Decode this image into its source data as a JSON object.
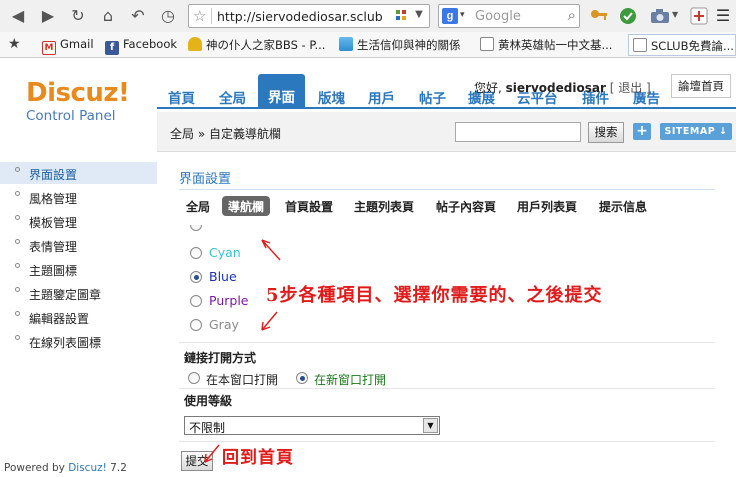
{
  "browser": {
    "url": "http://siervodediosar.sclub",
    "search_placeholder": "Google",
    "search_engine_letter": "g",
    "bookmarks": [
      {
        "label": "Gmail",
        "icon": "gmail-icon",
        "color": "#d93025"
      },
      {
        "label": "Facebook",
        "icon": "facebook-icon",
        "color": "#3b5998"
      },
      {
        "label": "神の仆人之家BBS - P...",
        "icon": "trophy-icon",
        "color": "#e4b21b"
      },
      {
        "label": "生活信仰與神的關係",
        "icon": "photo-icon",
        "color": "#2f8fd0"
      },
      {
        "label": "黄林英雄帖一中文基...",
        "icon": "page-icon",
        "color": "#ffffff"
      },
      {
        "label": "SCLUB免費論...",
        "icon": "page-icon",
        "color": "#ffffff"
      }
    ]
  },
  "logo": {
    "title": "Discuz!",
    "subtitle": "Control Panel"
  },
  "nav": {
    "items": [
      "首頁",
      "全局",
      "界面",
      "版塊",
      "用戶",
      "帖子",
      "擴展",
      "云平台",
      "插件",
      "廣告"
    ],
    "active_index": 2
  },
  "user": {
    "greeting": "您好,",
    "name": "siervodediosar",
    "logout": "[ 退出 ]",
    "home_button": "論壇首頁"
  },
  "breadcrumb": {
    "home": "全局",
    "sep": "»",
    "current": "自定義導航欄"
  },
  "quick_search": {
    "button": "搜索",
    "plus": "+",
    "sitemap": "SITEMAP ↓"
  },
  "sidebar": {
    "items": [
      "界面設置",
      "風格管理",
      "模板管理",
      "表情管理",
      "主題圖標",
      "主題鑒定圖章",
      "編輯器設置",
      "在線列表圖標"
    ],
    "active_index": 0,
    "powered_prefix": "Powered by",
    "powered_brand": "Discuz!",
    "powered_version": "7.2"
  },
  "main": {
    "title": "界面設置",
    "tabs": [
      "全局",
      "導航欄",
      "首頁設置",
      "主題列表頁",
      "帖子內容頁",
      "用戶列表頁",
      "提示信息"
    ],
    "active_tab_index": 1,
    "color_options": [
      {
        "label": "Cyan",
        "color": "#36c2d6",
        "selected": false
      },
      {
        "label": "Blue",
        "color": "#1c2fb7",
        "selected": true
      },
      {
        "label": "Purple",
        "color": "#7b18a6",
        "selected": false
      },
      {
        "label": "Gray",
        "color": "#8a8a8a",
        "selected": false
      }
    ],
    "link_open": {
      "label": "鏈接打開方式",
      "options": [
        {
          "label": "在本窗口打開",
          "selected": false
        },
        {
          "label": "在新窗口打開",
          "selected": true
        }
      ]
    },
    "level": {
      "label": "使用等級",
      "value": "不限制"
    },
    "submit": "提交"
  },
  "annotations": {
    "instruction": "5步各種項目、選擇你需要的、之後提交",
    "back_home": "回到首頁"
  }
}
